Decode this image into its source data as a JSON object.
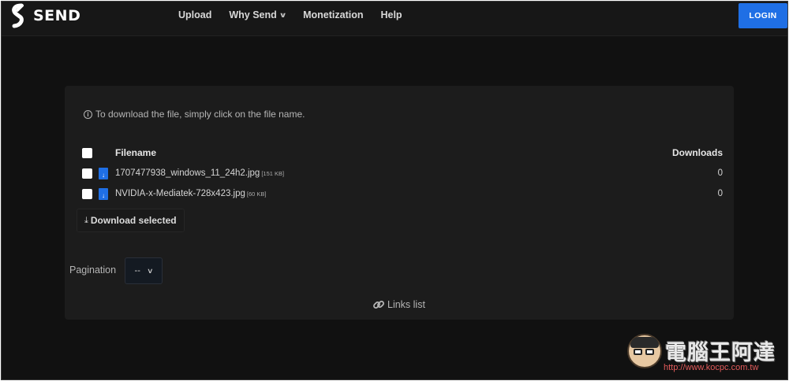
{
  "header": {
    "brand": "SEND",
    "nav": [
      {
        "label": "Upload"
      },
      {
        "label": "Why Send",
        "has_dropdown": true
      },
      {
        "label": "Monetization"
      },
      {
        "label": "Help"
      }
    ],
    "login_label": "LOGIN"
  },
  "main": {
    "info_text": "To download the file, simply click on the file name.",
    "table": {
      "columns": [
        "Filename",
        "Downloads"
      ],
      "rows": [
        {
          "filename": "1707477938_windows_11_24h2.jpg",
          "size": "[151 KB]",
          "downloads": "0"
        },
        {
          "filename": "NVIDIA-x-Mediatek-728x423.jpg",
          "size": "[60 KB]",
          "downloads": "0"
        }
      ]
    },
    "download_selected_label": "Download selected",
    "pagination": {
      "label": "Pagination",
      "selected": "--"
    },
    "links_list_label": "Links list"
  },
  "watermark": {
    "text": "電腦王阿達",
    "url": "http://www.kocpc.com.tw"
  },
  "colors": {
    "accent": "#1f6fe5",
    "background": "#111111",
    "panel": "#1c1c1c"
  },
  "icons": [
    "send-logo-icon",
    "chevron-down-icon",
    "info-icon",
    "file-download-icon",
    "download-icon",
    "link-icon"
  ]
}
